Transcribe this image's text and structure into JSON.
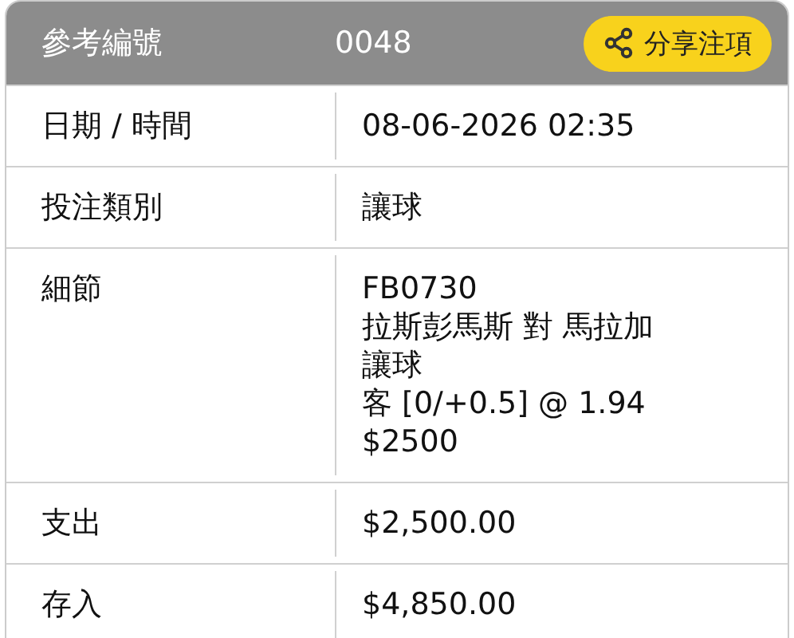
{
  "header": {
    "label": "參考編號",
    "value": "0048",
    "share_button": "分享注項"
  },
  "rows": [
    {
      "label": "日期 / 時間",
      "lines": [
        "08-06-2026 02:35"
      ]
    },
    {
      "label": "投注類別",
      "lines": [
        "讓球"
      ]
    },
    {
      "label": "細節",
      "lines": [
        "FB0730",
        "拉斯彭馬斯 對 馬拉加",
        "讓球",
        "客 [0/+0.5] @ 1.94",
        "$2500"
      ]
    },
    {
      "label": "支出",
      "lines": [
        "$2,500.00"
      ]
    },
    {
      "label": "存入",
      "lines": [
        "$4,850.00"
      ]
    }
  ]
}
